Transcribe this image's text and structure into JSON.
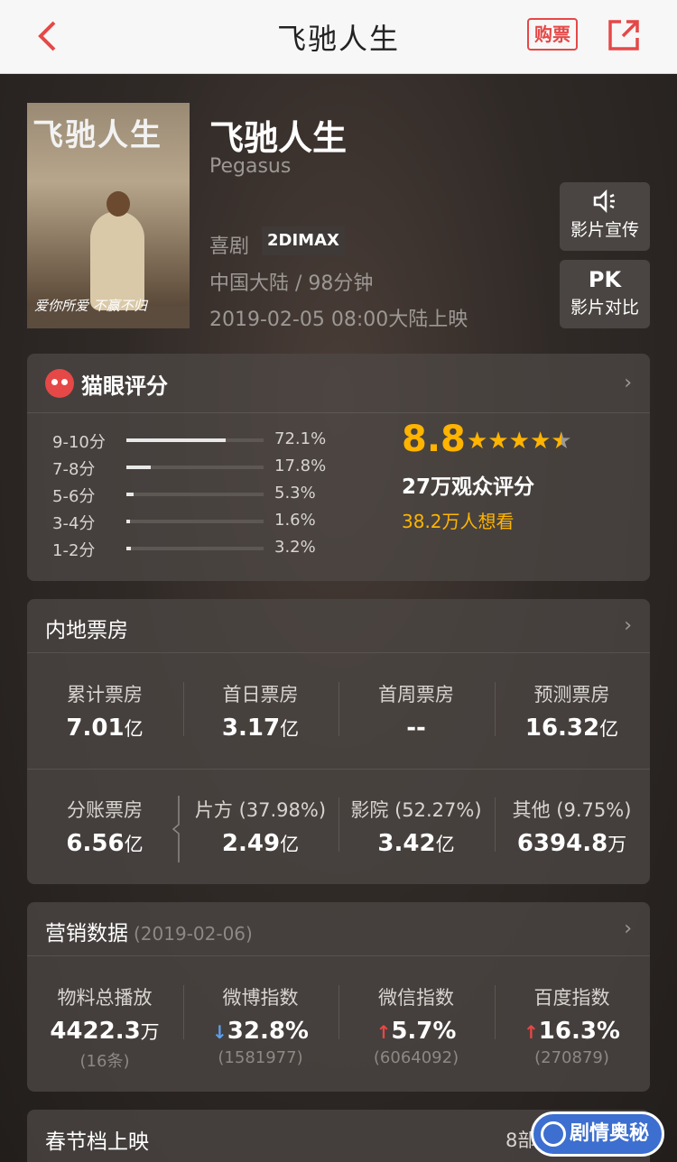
{
  "nav": {
    "title": "飞驰人生",
    "buy_label": "购票"
  },
  "movie": {
    "poster_title": "飞驰人生",
    "poster_tagline": "爱你所爱 不赢不归",
    "title": "飞驰人生",
    "english_title": "Pegasus",
    "genre": "喜剧",
    "format": "2DIMAX",
    "region_duration": "中国大陆 / 98分钟",
    "release": "2019-02-05 08:00大陆上映"
  },
  "side_buttons": [
    {
      "icon": "speaker-icon",
      "label": "影片宣传"
    },
    {
      "icon_text": "PK",
      "label": "影片对比"
    }
  ],
  "rating": {
    "title": "猫眼评分",
    "distribution": [
      {
        "label": "9-10分",
        "pct": "72.1%",
        "value": 0.721
      },
      {
        "label": "7-8分",
        "pct": "17.8%",
        "value": 0.178
      },
      {
        "label": "5-6分",
        "pct": "5.3%",
        "value": 0.053
      },
      {
        "label": "3-4分",
        "pct": "1.6%",
        "value": 0.016
      },
      {
        "label": "1-2分",
        "pct": "3.2%",
        "value": 0.032
      }
    ],
    "score": "8.8",
    "stars": 4.5,
    "voters": "27万观众评分",
    "wish": "38.2万人想看"
  },
  "box_office": {
    "title": "内地票房",
    "row1": [
      {
        "label": "累计票房",
        "num": "7.01",
        "unit": "亿"
      },
      {
        "label": "首日票房",
        "num": "3.17",
        "unit": "亿"
      },
      {
        "label": "首周票房",
        "num": "--",
        "unit": ""
      },
      {
        "label": "预测票房",
        "num": "16.32",
        "unit": "亿"
      }
    ],
    "row2": [
      {
        "label": "分账票房",
        "num": "6.56",
        "unit": "亿"
      },
      {
        "label": "片方 (37.98%)",
        "num": "2.49",
        "unit": "亿"
      },
      {
        "label": "影院 (52.27%)",
        "num": "3.42",
        "unit": "亿"
      },
      {
        "label": "其他 (9.75%)",
        "num": "6394.8",
        "unit": "万"
      }
    ]
  },
  "marketing": {
    "title": "营销数据",
    "date": "(2019-02-06)",
    "items": [
      {
        "label": "物料总播放",
        "num": "4422.3",
        "unit": "万",
        "sub": "(16条)",
        "trend": ""
      },
      {
        "label": "微博指数",
        "num": "32.8%",
        "unit": "",
        "sub": "(1581977)",
        "trend": "down"
      },
      {
        "label": "微信指数",
        "num": "5.7%",
        "unit": "",
        "sub": "(6064092)",
        "trend": "up"
      },
      {
        "label": "百度指数",
        "num": "16.3%",
        "unit": "",
        "sub": "(270879)",
        "trend": "up"
      }
    ]
  },
  "spring": {
    "title": "春节档上映",
    "right": "8部"
  },
  "watermark": {
    "text": "剧情奥秘"
  }
}
